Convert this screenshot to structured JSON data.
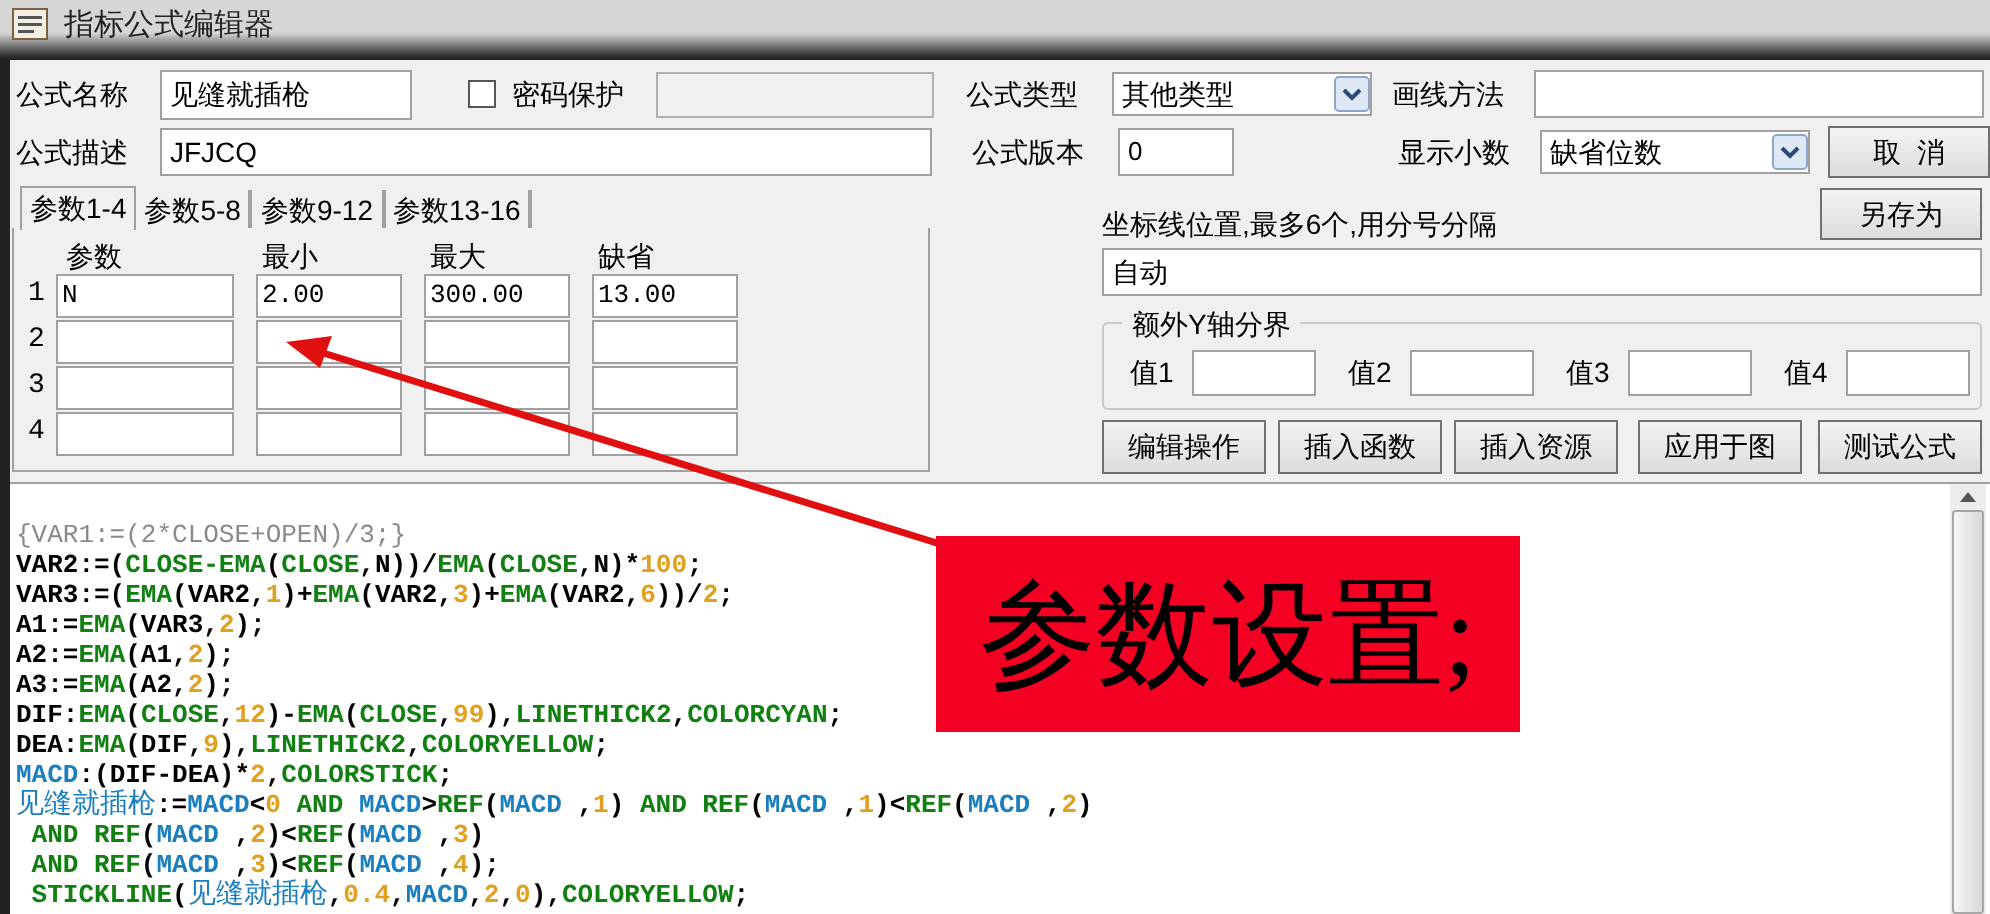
{
  "window": {
    "title": "指标公式编辑器"
  },
  "form": {
    "name": {
      "label": "公式名称",
      "value": "见缝就插枪"
    },
    "password": {
      "label": "密码保护",
      "checked": false
    },
    "formula_type": {
      "label": "公式类型",
      "value": "其他类型"
    },
    "draw_method": {
      "label": "画线方法"
    },
    "description": {
      "label": "公式描述",
      "value": "JFJCQ"
    },
    "version": {
      "label": "公式版本",
      "value": "0"
    },
    "decimals": {
      "label": "显示小数",
      "value": "缺省位数"
    }
  },
  "side_buttons": [
    "取  消",
    "另存为"
  ],
  "param_tabs": [
    {
      "label": "参数1-4",
      "selected": true
    },
    {
      "label": "参数5-8",
      "selected": false
    },
    {
      "label": "参数9-12",
      "selected": false
    },
    {
      "label": "参数13-16",
      "selected": false
    }
  ],
  "param_table": {
    "columns": [
      "参数",
      "最小",
      "最大",
      "缺省"
    ],
    "rows": [
      {
        "index": "1",
        "values": [
          "N",
          "2.00",
          "300.00",
          "13.00"
        ]
      },
      {
        "index": "2"
      },
      {
        "index": "3"
      },
      {
        "index": "4"
      }
    ]
  },
  "axis_lines": {
    "label": "坐标线位置,最多6个,用分号分隔",
    "value": "自动"
  },
  "extra_y": {
    "title": "额外Y轴分界",
    "fields": [
      "值1",
      "值2",
      "值3",
      "值4"
    ]
  },
  "action_buttons": [
    "编辑操作",
    "插入函数",
    "插入资源",
    "应用于图",
    "测试公式"
  ],
  "editor": {
    "lines": [
      [
        {
          "kind": "comment",
          "text": "{VAR1:=(2*CLOSE+OPEN)/3;}"
        }
      ],
      [
        {
          "kind": "plain",
          "text": "VAR2:=("
        },
        {
          "kind": "func",
          "text": "CLOSE-EMA"
        },
        {
          "kind": "plain",
          "text": "("
        },
        {
          "kind": "func",
          "text": "CLOSE"
        },
        {
          "kind": "plain",
          "text": ",N))/"
        },
        {
          "kind": "func",
          "text": "EMA"
        },
        {
          "kind": "plain",
          "text": "("
        },
        {
          "kind": "func",
          "text": "CLOSE"
        },
        {
          "kind": "plain",
          "text": ",N)*"
        },
        {
          "kind": "num",
          "text": "100"
        },
        {
          "kind": "plain",
          "text": ";"
        }
      ],
      [
        {
          "kind": "plain",
          "text": "VAR3:=("
        },
        {
          "kind": "func",
          "text": "EMA"
        },
        {
          "kind": "plain",
          "text": "(VAR2,"
        },
        {
          "kind": "num",
          "text": "1"
        },
        {
          "kind": "plain",
          "text": ")+"
        },
        {
          "kind": "func",
          "text": "EMA"
        },
        {
          "kind": "plain",
          "text": "(VAR2,"
        },
        {
          "kind": "num",
          "text": "3"
        },
        {
          "kind": "plain",
          "text": ")+"
        },
        {
          "kind": "func",
          "text": "EMA"
        },
        {
          "kind": "plain",
          "text": "(VAR2,"
        },
        {
          "kind": "num",
          "text": "6"
        },
        {
          "kind": "plain",
          "text": "))/"
        },
        {
          "kind": "num",
          "text": "2"
        },
        {
          "kind": "plain",
          "text": ";"
        }
      ],
      [
        {
          "kind": "plain",
          "text": "A1:="
        },
        {
          "kind": "func",
          "text": "EMA"
        },
        {
          "kind": "plain",
          "text": "(VAR3,"
        },
        {
          "kind": "num",
          "text": "2"
        },
        {
          "kind": "plain",
          "text": ");"
        }
      ],
      [
        {
          "kind": "plain",
          "text": "A2:="
        },
        {
          "kind": "func",
          "text": "EMA"
        },
        {
          "kind": "plain",
          "text": "(A1,"
        },
        {
          "kind": "num",
          "text": "2"
        },
        {
          "kind": "plain",
          "text": ");"
        }
      ],
      [
        {
          "kind": "plain",
          "text": "A3:="
        },
        {
          "kind": "func",
          "text": "EMA"
        },
        {
          "kind": "plain",
          "text": "(A2,"
        },
        {
          "kind": "num",
          "text": "2"
        },
        {
          "kind": "plain",
          "text": ");"
        }
      ],
      [
        {
          "kind": "plain",
          "text": "DIF:"
        },
        {
          "kind": "func",
          "text": "EMA"
        },
        {
          "kind": "plain",
          "text": "("
        },
        {
          "kind": "func",
          "text": "CLOSE"
        },
        {
          "kind": "plain",
          "text": ","
        },
        {
          "kind": "num",
          "text": "12"
        },
        {
          "kind": "plain",
          "text": ")-"
        },
        {
          "kind": "func",
          "text": "EMA"
        },
        {
          "kind": "plain",
          "text": "("
        },
        {
          "kind": "func",
          "text": "CLOSE"
        },
        {
          "kind": "plain",
          "text": ","
        },
        {
          "kind": "num",
          "text": "99"
        },
        {
          "kind": "plain",
          "text": "),"
        },
        {
          "kind": "func",
          "text": "LINETHICK2"
        },
        {
          "kind": "plain",
          "text": ","
        },
        {
          "kind": "func",
          "text": "COLORCYAN"
        },
        {
          "kind": "plain",
          "text": ";"
        }
      ],
      [
        {
          "kind": "plain",
          "text": "DEA:"
        },
        {
          "kind": "func",
          "text": "EMA"
        },
        {
          "kind": "plain",
          "text": "(DIF,"
        },
        {
          "kind": "num",
          "text": "9"
        },
        {
          "kind": "plain",
          "text": "),"
        },
        {
          "kind": "func",
          "text": "LINETHICK2"
        },
        {
          "kind": "plain",
          "text": ","
        },
        {
          "kind": "func",
          "text": "COLORYELLOW"
        },
        {
          "kind": "plain",
          "text": ";"
        }
      ],
      [
        {
          "kind": "var",
          "text": "MACD"
        },
        {
          "kind": "plain",
          "text": ":(DIF-DEA)*"
        },
        {
          "kind": "num",
          "text": "2"
        },
        {
          "kind": "plain",
          "text": ","
        },
        {
          "kind": "func",
          "text": "COLORSTICK"
        },
        {
          "kind": "plain",
          "text": ";"
        }
      ],
      [
        {
          "kind": "var",
          "text": "见缝就插枪"
        },
        {
          "kind": "plain",
          "text": ":="
        },
        {
          "kind": "var",
          "text": "MACD"
        },
        {
          "kind": "plain",
          "text": "<"
        },
        {
          "kind": "num",
          "text": "0"
        },
        {
          "kind": "func",
          "text": " AND "
        },
        {
          "kind": "var",
          "text": "MACD"
        },
        {
          "kind": "plain",
          "text": ">"
        },
        {
          "kind": "func",
          "text": "REF"
        },
        {
          "kind": "plain",
          "text": "("
        },
        {
          "kind": "var",
          "text": "MACD"
        },
        {
          "kind": "plain",
          "text": " ,"
        },
        {
          "kind": "num",
          "text": "1"
        },
        {
          "kind": "plain",
          "text": ") "
        },
        {
          "kind": "func",
          "text": "AND REF"
        },
        {
          "kind": "plain",
          "text": "("
        },
        {
          "kind": "var",
          "text": "MACD"
        },
        {
          "kind": "plain",
          "text": " ,"
        },
        {
          "kind": "num",
          "text": "1"
        },
        {
          "kind": "plain",
          "text": ")<"
        },
        {
          "kind": "func",
          "text": "REF"
        },
        {
          "kind": "plain",
          "text": "("
        },
        {
          "kind": "var",
          "text": "MACD"
        },
        {
          "kind": "plain",
          "text": " ,"
        },
        {
          "kind": "num",
          "text": "2"
        },
        {
          "kind": "plain",
          "text": ")"
        }
      ],
      [
        {
          "kind": "func",
          "text": " AND REF"
        },
        {
          "kind": "plain",
          "text": "("
        },
        {
          "kind": "var",
          "text": "MACD"
        },
        {
          "kind": "plain",
          "text": " ,"
        },
        {
          "kind": "num",
          "text": "2"
        },
        {
          "kind": "plain",
          "text": ")<"
        },
        {
          "kind": "func",
          "text": "REF"
        },
        {
          "kind": "plain",
          "text": "("
        },
        {
          "kind": "var",
          "text": "MACD"
        },
        {
          "kind": "plain",
          "text": " ,"
        },
        {
          "kind": "num",
          "text": "3"
        },
        {
          "kind": "plain",
          "text": ")"
        }
      ],
      [
        {
          "kind": "func",
          "text": " AND REF"
        },
        {
          "kind": "plain",
          "text": "("
        },
        {
          "kind": "var",
          "text": "MACD"
        },
        {
          "kind": "plain",
          "text": " ,"
        },
        {
          "kind": "num",
          "text": "3"
        },
        {
          "kind": "plain",
          "text": ")<"
        },
        {
          "kind": "func",
          "text": "REF"
        },
        {
          "kind": "plain",
          "text": "("
        },
        {
          "kind": "var",
          "text": "MACD"
        },
        {
          "kind": "plain",
          "text": " ,"
        },
        {
          "kind": "num",
          "text": "4"
        },
        {
          "kind": "plain",
          "text": ");"
        }
      ],
      [
        {
          "kind": "func",
          "text": " STICKLINE"
        },
        {
          "kind": "plain",
          "text": "("
        },
        {
          "kind": "var",
          "text": "见缝就插枪"
        },
        {
          "kind": "plain",
          "text": ","
        },
        {
          "kind": "num",
          "text": "0.4"
        },
        {
          "kind": "plain",
          "text": ","
        },
        {
          "kind": "var",
          "text": "MACD"
        },
        {
          "kind": "plain",
          "text": ","
        },
        {
          "kind": "num",
          "text": "2"
        },
        {
          "kind": "plain",
          "text": ","
        },
        {
          "kind": "num",
          "text": "0"
        },
        {
          "kind": "plain",
          "text": "),"
        },
        {
          "kind": "func",
          "text": "COLORYELLOW"
        },
        {
          "kind": "plain",
          "text": ";"
        }
      ]
    ]
  },
  "annotation": {
    "text": "参数设置;"
  }
}
